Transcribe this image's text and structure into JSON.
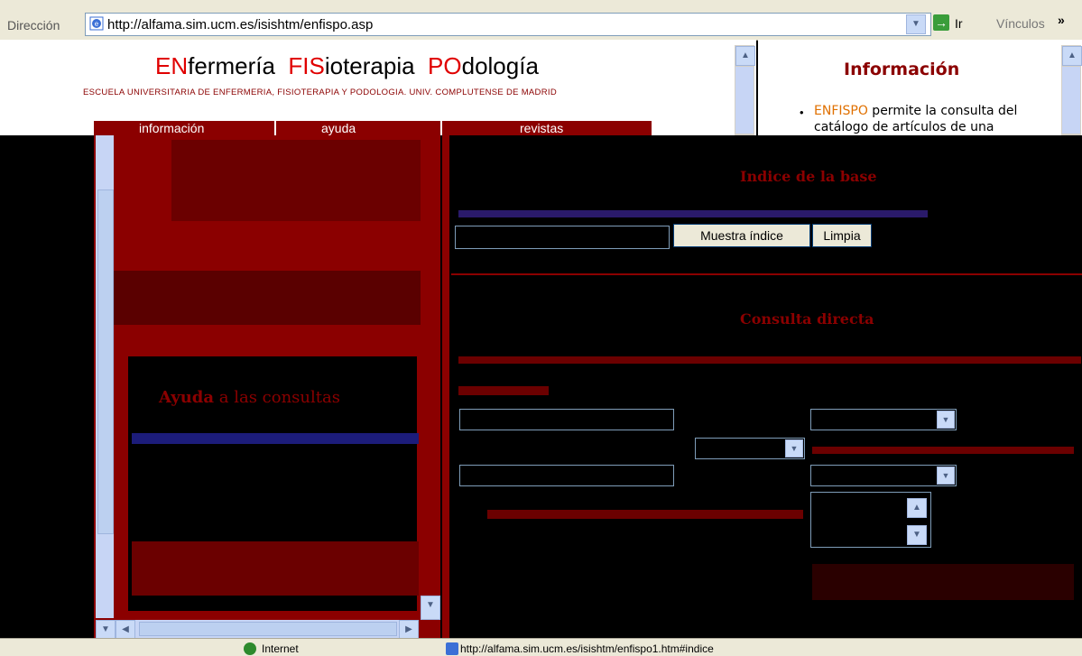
{
  "address_bar": {
    "label": "Dirección",
    "url": "http://alfama.sim.ucm.es/isishtm/enfispo.asp",
    "go_label": "Ir",
    "links_label": "Vínculos",
    "more": "»"
  },
  "header": {
    "logo": {
      "en": "EN",
      "fermeria": "fermería",
      "fis": "FIS",
      "ioterapia": "ioterapia",
      "po": "PO",
      "dologia": "dología"
    },
    "subtitle": "ESCUELA UNIVERSITARIA DE ENFERMERIA, FISIOTERAPIA Y PODOLOGIA. UNIV. COMPLUTENSE DE MADRID",
    "nav": [
      "información",
      "ayuda",
      "revistas"
    ]
  },
  "info_panel": {
    "title": "Información",
    "bullet": "•",
    "link": "ENFISPO",
    "text": " permite la consulta del catálogo de artículos de una"
  },
  "left_panel": {
    "ayuda_title": "Ayuda",
    "ayuda_rest": " a las consultas"
  },
  "index_section": {
    "title": "Indice de la base",
    "buttons": {
      "show": "Muestra índice",
      "clear": "Limpia"
    }
  },
  "query_section": {
    "title": "Consulta directa"
  },
  "status_bar": {
    "zone": "Internet",
    "url": "http://alfama.sim.ucm.es/isishtm/enfispo1.htm#indice"
  },
  "icons": {
    "up": "▲",
    "down": "▼",
    "left": "◀",
    "right": "▶",
    "go": "→"
  }
}
